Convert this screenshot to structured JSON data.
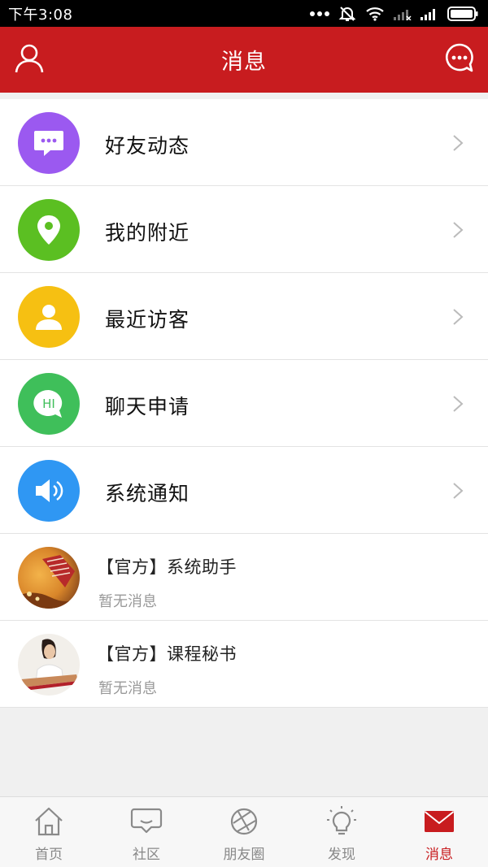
{
  "status_bar": {
    "time": "下午3:08"
  },
  "header": {
    "title": "消息",
    "accent_color": "#c81c1f"
  },
  "menu_items": [
    {
      "label": "好友动态",
      "icon": "chat-bubble-icon",
      "color": "#9b59f0"
    },
    {
      "label": "我的附近",
      "icon": "location-pin-icon",
      "color": "#5bbf22"
    },
    {
      "label": "最近访客",
      "icon": "person-icon",
      "color": "#f6c012"
    },
    {
      "label": "聊天申请",
      "icon": "hi-bubble-icon",
      "color": "#3fbf5a"
    },
    {
      "label": "系统通知",
      "icon": "speaker-icon",
      "color": "#2f97f3"
    }
  ],
  "conversations": [
    {
      "title": "【官方】系统助手",
      "subtitle": "暂无消息"
    },
    {
      "title": "【官方】课程秘书",
      "subtitle": "暂无消息"
    }
  ],
  "bottom_nav": {
    "items": [
      {
        "label": "首页",
        "icon": "home-icon",
        "active": false
      },
      {
        "label": "社区",
        "icon": "community-chat-icon",
        "active": false
      },
      {
        "label": "朋友圈",
        "icon": "aperture-icon",
        "active": false
      },
      {
        "label": "发现",
        "icon": "lightbulb-icon",
        "active": false
      },
      {
        "label": "消息",
        "icon": "envelope-icon",
        "active": true
      }
    ]
  }
}
